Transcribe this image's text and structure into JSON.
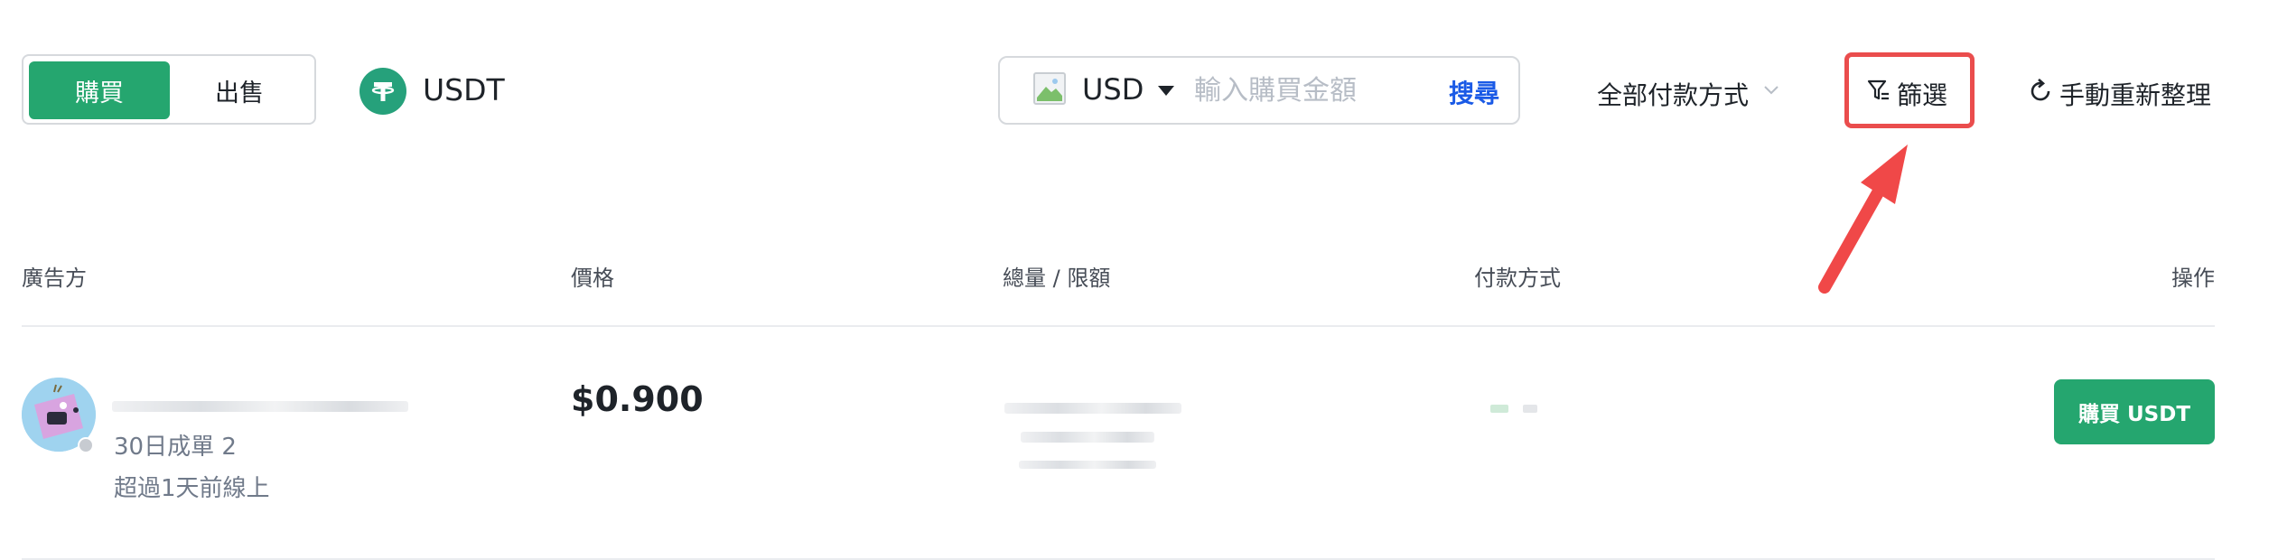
{
  "toggle": {
    "buy_label": "購買",
    "sell_label": "出售"
  },
  "coin": {
    "label": "USDT",
    "icon": "tether-icon",
    "color": "#26a17b"
  },
  "search": {
    "currency": "USD",
    "placeholder": "輸入購買金額",
    "button_label": "搜尋"
  },
  "payment_filter": {
    "label": "全部付款方式"
  },
  "filter": {
    "label": "篩選"
  },
  "refresh": {
    "label": "手動重新整理"
  },
  "table": {
    "headers": [
      "廣告方",
      "價格",
      "總量 / 限額",
      "付款方式",
      "操作"
    ],
    "rows": [
      {
        "trades_30d": "30日成單 2",
        "last_online": "超過1天前線上",
        "price": "$0.900",
        "action_label": "購買 USDT"
      }
    ]
  },
  "colors": {
    "accent_green": "#25a66f",
    "link_blue": "#1a5ae6",
    "highlight_red": "#ea4d4d"
  }
}
